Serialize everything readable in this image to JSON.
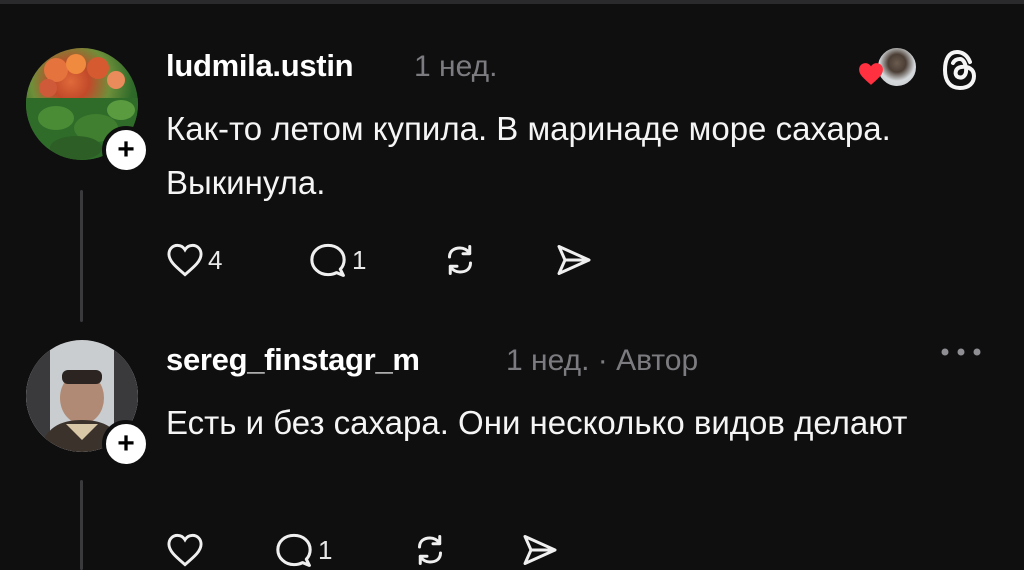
{
  "posts": [
    {
      "username": "ludmila.ustin",
      "time": "1 нед.",
      "text": "Как-то летом купила. В маринаде море сахара. Выкинула.",
      "likes": "4",
      "replies": "1",
      "avatar_icon": "flowers-avatar",
      "follow_icon": "plus-icon",
      "follow_glyph": "+"
    },
    {
      "username": "sereg_finstagr_m",
      "meta": "1 нед. · Автор",
      "text": "Есть и без сахара. Они несколько видов делают",
      "likes": "",
      "replies": "1",
      "avatar_icon": "man-in-car-avatar",
      "follow_icon": "plus-icon",
      "follow_glyph": "+"
    }
  ],
  "colors": {
    "background": "#0f0f10",
    "text": "#f5f5f5",
    "muted": "#7c7c80",
    "heart": "#ff3040"
  }
}
